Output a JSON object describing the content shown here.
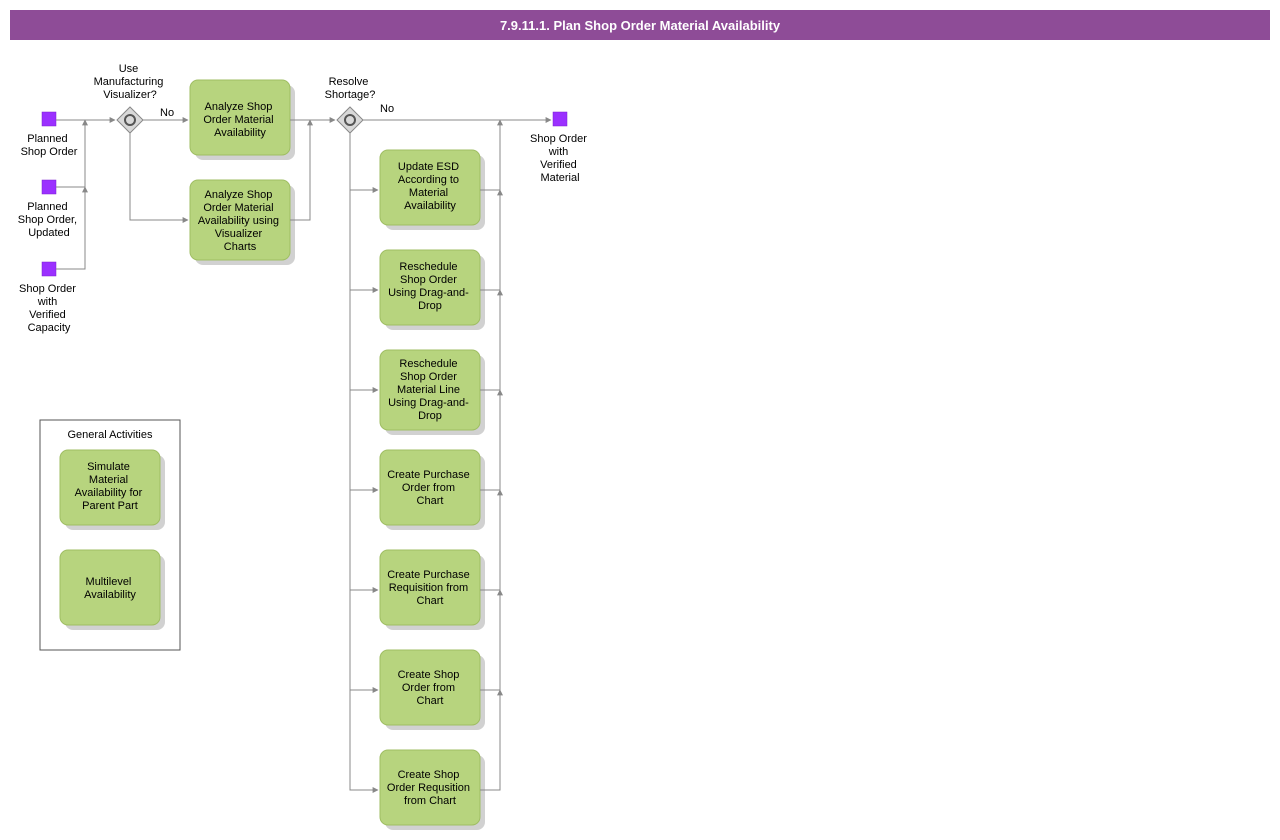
{
  "header": {
    "title": "7.9.11.1. Plan Shop Order Material Availability"
  },
  "events": {
    "in1": [
      "Planned",
      "Shop Order"
    ],
    "in2": [
      "Planned",
      "Shop Order,",
      "Updated"
    ],
    "in3": [
      "Shop Order",
      "with",
      "Verified",
      "Capacity"
    ],
    "out": [
      "Shop Order",
      "with",
      "Verified",
      "Material"
    ]
  },
  "decisions": {
    "d1": [
      "Use",
      "Manufacturing",
      "Visualizer?"
    ],
    "d1_no": "No",
    "d2": [
      "Resolve",
      "Shortage?"
    ],
    "d2_no": "No"
  },
  "activities": {
    "a1": [
      "Analyze Shop",
      "Order Material",
      "Availability"
    ],
    "a2": [
      "Analyze Shop",
      "Order Material",
      "Availability using",
      "Visualizer",
      "Charts"
    ],
    "r1": [
      "Update ESD",
      "According to",
      "Material",
      "Availability"
    ],
    "r2": [
      "Reschedule",
      "Shop Order",
      "Using Drag-and-",
      "Drop"
    ],
    "r3": [
      "Reschedule",
      "Shop Order",
      "Material Line",
      "Using Drag-and-",
      "Drop"
    ],
    "r4": [
      "Create Purchase",
      "Order from",
      "Chart"
    ],
    "r5": [
      "Create Purchase",
      "Requisition from",
      "Chart"
    ],
    "r6": [
      "Create Shop",
      "Order from",
      "Chart"
    ],
    "r7": [
      "Create Shop",
      "Order Requsition",
      "from Chart"
    ],
    "g1": [
      "Simulate",
      "Material",
      "Availability for",
      "Parent Part"
    ],
    "g2": [
      "Multilevel",
      "Availability"
    ]
  },
  "group": {
    "title": "General Activities"
  }
}
